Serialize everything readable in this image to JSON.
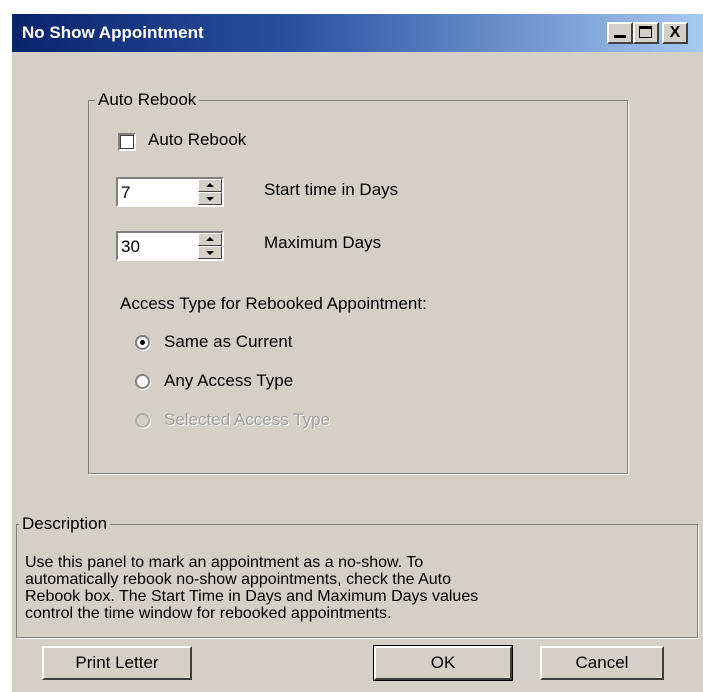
{
  "window": {
    "title": "No Show Appointment",
    "minimize_icon": "minimize-icon",
    "maximize_icon": "maximize-icon",
    "close_glyph": "X"
  },
  "auto_rebook": {
    "group_label": "Auto Rebook",
    "checkbox_label": "Auto Rebook",
    "checked": false,
    "start_time": {
      "value": "7",
      "label": "Start time in Days"
    },
    "maximum_days": {
      "value": "30",
      "label": "Maximum Days"
    },
    "access_type_heading": "Access Type for Rebooked Appointment:",
    "options": [
      {
        "label": "Same as Current",
        "selected": true,
        "enabled": true
      },
      {
        "label": "Any Access Type",
        "selected": false,
        "enabled": true
      },
      {
        "label": "Selected Access Type",
        "selected": false,
        "enabled": false
      }
    ]
  },
  "description": {
    "group_label": "Description",
    "lines": [
      "Use this panel to mark an appointment as a no-show. To",
      "automatically rebook no-show appointments, check the Auto",
      "Rebook box.  The Start Time in Days and Maximum Days values",
      "control the time window for rebooked appointments."
    ]
  },
  "buttons": {
    "print_letter": "Print Letter",
    "ok": "OK",
    "cancel": "Cancel"
  }
}
